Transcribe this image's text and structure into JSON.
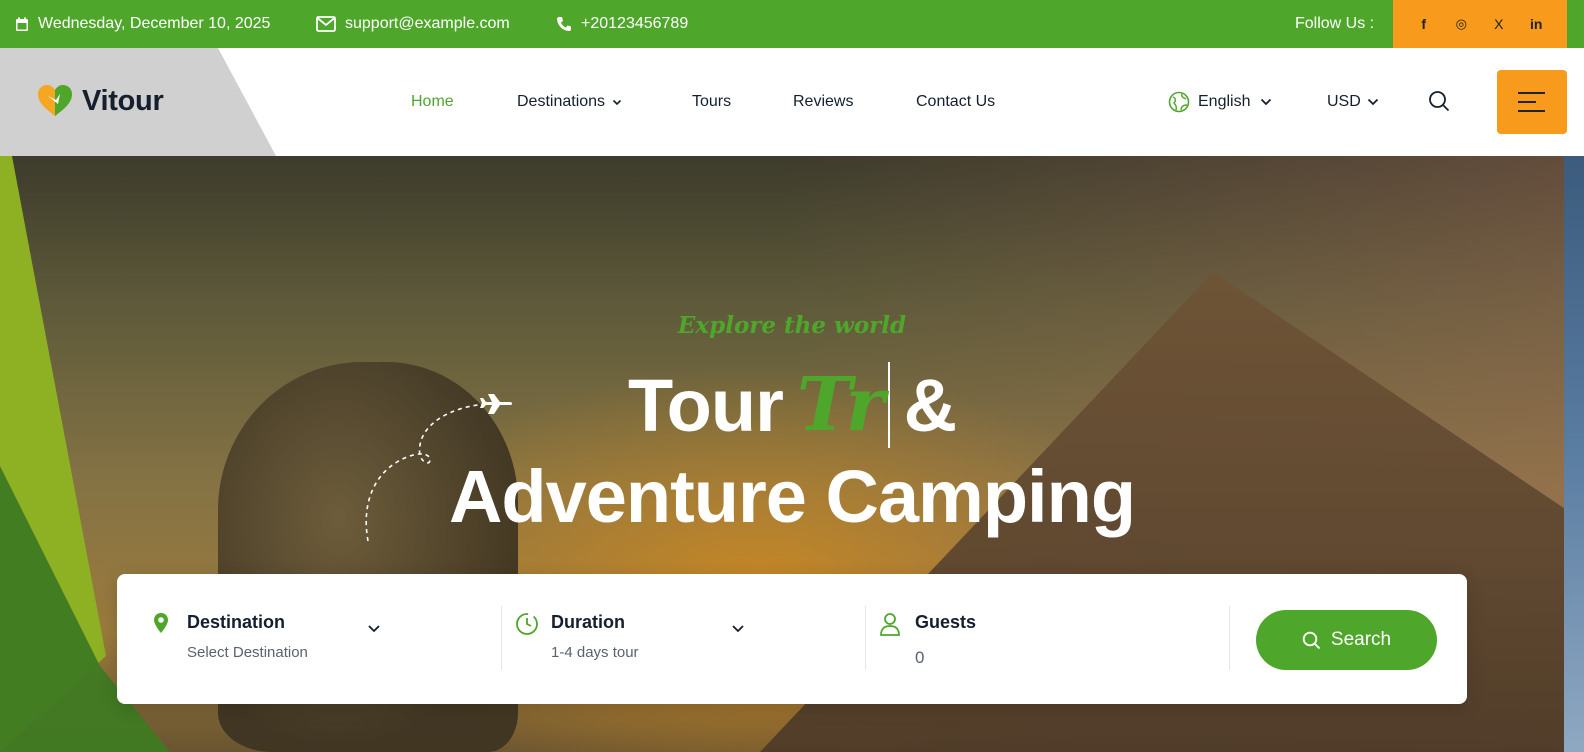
{
  "topbar": {
    "date": "Wednesday, December 10, 2025",
    "email": "support@example.com",
    "phone": "+20123456789",
    "follow_label": "Follow Us :",
    "socials": [
      {
        "icon": "facebook-icon",
        "glyph": "f"
      },
      {
        "icon": "instagram-icon",
        "glyph": "◎"
      },
      {
        "icon": "x-twitter-icon",
        "glyph": "X"
      },
      {
        "icon": "linkedin-icon",
        "glyph": "in"
      }
    ]
  },
  "header": {
    "logo_text": "Vitour",
    "nav": {
      "home": "Home",
      "destinations": "Destinations",
      "tours": "Tours",
      "reviews": "Reviews",
      "contact": "Contact Us"
    },
    "language": "English",
    "currency": "USD"
  },
  "hero": {
    "tagline": "Explore the world",
    "title_word1": "Tour",
    "title_typed": "Tr",
    "title_amp": "&",
    "title_line2": "Adventure Camping"
  },
  "search": {
    "destination": {
      "title": "Destination",
      "value": "Select Destination"
    },
    "duration": {
      "title": "Duration",
      "value": "1-4 days tour"
    },
    "guests": {
      "title": "Guests",
      "value": "0"
    },
    "button_label": "Search"
  },
  "colors": {
    "brand_green": "#4ea72a",
    "accent_orange": "#f89a1c",
    "text_dark": "#14202e"
  }
}
